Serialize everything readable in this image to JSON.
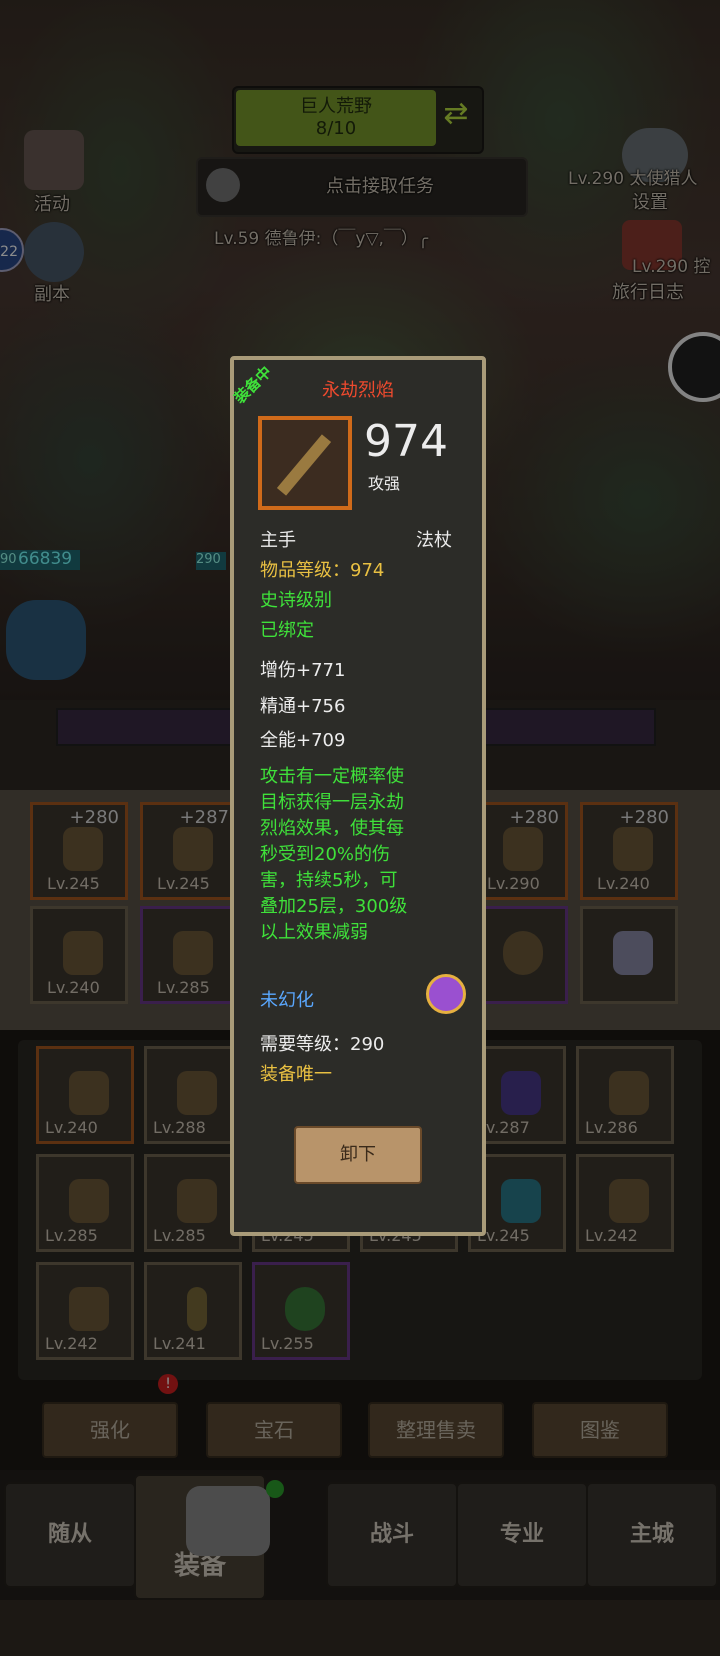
{
  "hud": {
    "zone_name": "巨人荒野",
    "zone_progress": "8/10",
    "quest_label": "点击接取任务",
    "player_line": "Lv.59 德鲁伊:（￣y▽,￣）╭",
    "left_icons": {
      "activity": "活动",
      "dungeon": "副本"
    },
    "right_icons": {
      "settings_line1": "Lv.290 太使猎人",
      "settings_line2": "设置",
      "journal_line1": "Lv.290 控",
      "journal_line2": "旅行日志"
    },
    "avatar_badge": "22",
    "hp_left": "90",
    "hp_value": "66839",
    "hp_right": "290"
  },
  "popup": {
    "equipped_tag": "装备中",
    "item_name": "永劫烈焰",
    "item_score": "974",
    "score_label": "攻强",
    "slot": "主手",
    "type": "法杖",
    "item_level": "物品等级：974",
    "rarity": "史诗级别",
    "bound": "已绑定",
    "stats": [
      "增伤+771",
      "精通+756",
      "全能+709"
    ],
    "effect": [
      "攻击有一定概率使",
      "目标获得一层永劫",
      "烈焰效果，使其每",
      "秒受到20%的伤",
      "害，持续5秒，可",
      "叠加25层，300级",
      "以上效果减弱"
    ],
    "transmog": "未幻化",
    "req_level": "需要等级：290",
    "unique": "装备唯一",
    "unequip_button": "卸下"
  },
  "equipped_slots": [
    {
      "level": "Lv.245",
      "plus": "+280"
    },
    {
      "level": "Lv.245",
      "plus": "+287"
    },
    {
      "level": "Lv.290",
      "plus": "+280"
    },
    {
      "level": "Lv.240",
      "plus": "+280"
    },
    {
      "level": "Lv.240",
      "plus": ""
    },
    {
      "level": "Lv.285",
      "plus": ""
    }
  ],
  "inventory": [
    {
      "level": "Lv.240"
    },
    {
      "level": "Lv.288"
    },
    {
      "level": "Lv.287"
    },
    {
      "level": "Lv.286"
    },
    {
      "level": "Lv.285"
    },
    {
      "level": "Lv.285"
    },
    {
      "level": "Lv.245"
    },
    {
      "level": "Lv.245"
    },
    {
      "level": "Lv.245"
    },
    {
      "level": "Lv.242"
    },
    {
      "level": "Lv.242"
    },
    {
      "level": "Lv.241"
    },
    {
      "level": "Lv.255"
    }
  ],
  "actions": [
    "强化",
    "宝石",
    "整理售卖",
    "图鉴"
  ],
  "tabs": [
    "随从",
    "装备",
    "战斗",
    "专业",
    "主城"
  ]
}
